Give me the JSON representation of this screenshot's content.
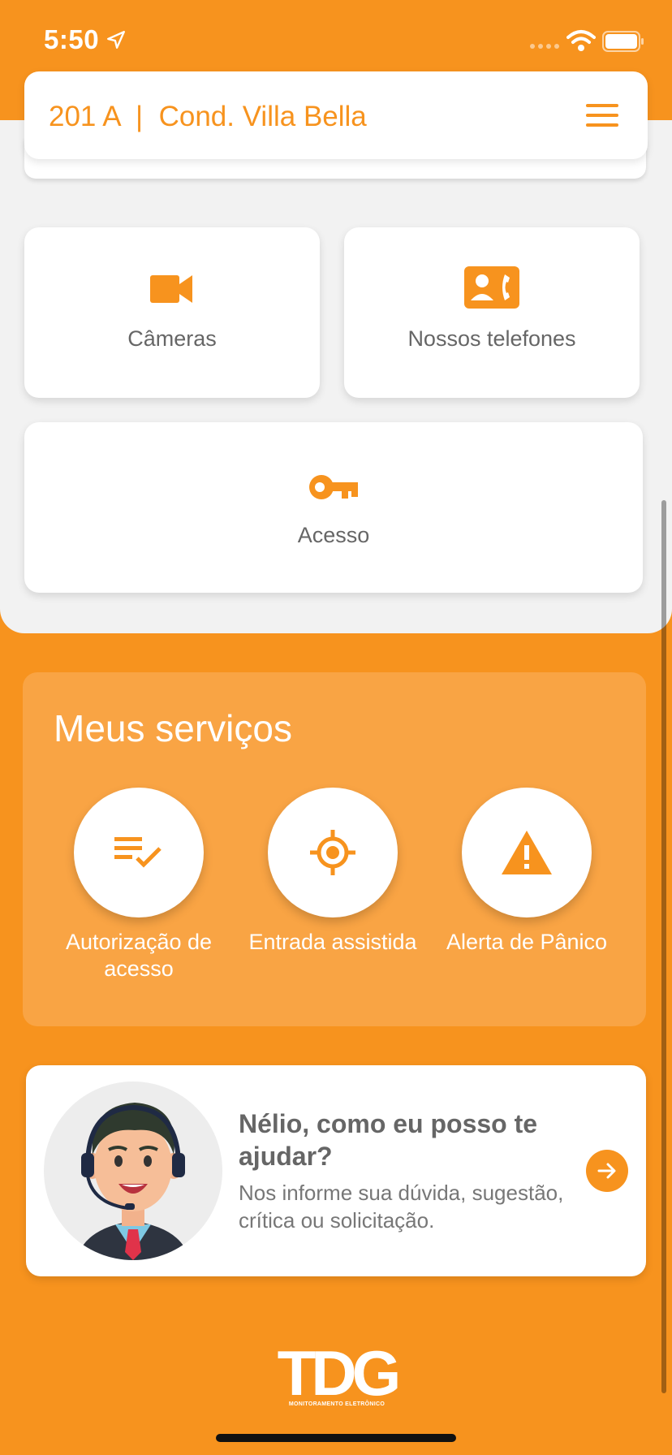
{
  "status_bar": {
    "time": "5:50"
  },
  "header": {
    "title": "201 A  |  Cond. Villa Bella"
  },
  "tiles": {
    "cameras": {
      "label": "Câmeras",
      "icon": "video-camera-icon"
    },
    "phones": {
      "label": "Nossos telefones",
      "icon": "contact-phone-icon"
    },
    "access": {
      "label": "Acesso",
      "icon": "key-icon"
    }
  },
  "services": {
    "title": "Meus serviços",
    "items": [
      {
        "label": "Autorização de acesso",
        "icon": "playlist-check-icon"
      },
      {
        "label": "Entrada assistida",
        "icon": "gps-target-icon"
      },
      {
        "label": "Alerta de Pânico",
        "icon": "warning-icon"
      }
    ]
  },
  "help": {
    "title": "Nélio, como eu posso te ajudar?",
    "subtitle": "Nos informe sua dúvida, sugestão, crítica ou solicitação."
  },
  "logo": {
    "text": "TDG",
    "tagline": "MONITORAMENTO ELETRÔNICO"
  },
  "colors": {
    "accent": "#F7931E",
    "services_bg": "#F9A444",
    "light_bg": "#F2F2F2"
  }
}
